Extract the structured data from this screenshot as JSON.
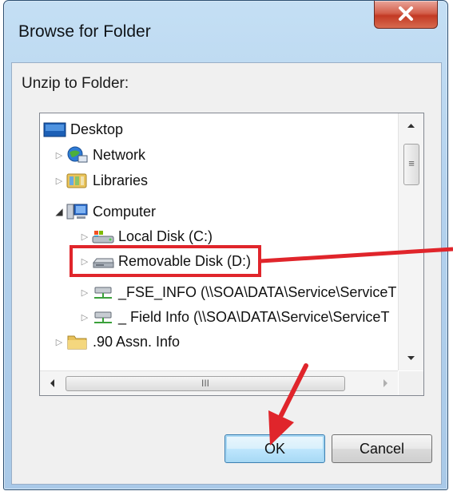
{
  "dialog": {
    "title": "Browse for Folder",
    "instruction": "Unzip to Folder:"
  },
  "tree": {
    "items": [
      {
        "label": "Desktop",
        "icon": "desktop-icon",
        "expander": ""
      },
      {
        "label": "Network",
        "icon": "network-icon",
        "expander": "▷"
      },
      {
        "label": "Libraries",
        "icon": "libraries-icon",
        "expander": "▷"
      },
      {
        "label": "Computer",
        "icon": "computer-icon",
        "expander": "◢"
      },
      {
        "label": "Local Disk (C:)",
        "icon": "local-disk-icon",
        "expander": "▷"
      },
      {
        "label": "Removable Disk (D:)",
        "icon": "removable-disk-icon",
        "expander": "▷"
      },
      {
        "label": "_FSE_INFO (\\\\SOA\\DATA\\Service\\ServiceT",
        "icon": "network-drive-icon",
        "expander": "▷"
      },
      {
        "label": "_ Field Info (\\\\SOA\\DATA\\Service\\ServiceT",
        "icon": "network-drive-icon",
        "expander": "▷"
      },
      {
        "label": ".90 Assn. Info",
        "icon": "folder-icon",
        "expander": "▷"
      }
    ]
  },
  "scrollbar": {
    "hgrip": "III",
    "vgrip": "≡"
  },
  "buttons": {
    "ok": "OK",
    "cancel": "Cancel"
  },
  "colors": {
    "annotation_red": "#e0252b",
    "title_bar": "#b4d2ee",
    "close_red": "#c33a24"
  }
}
